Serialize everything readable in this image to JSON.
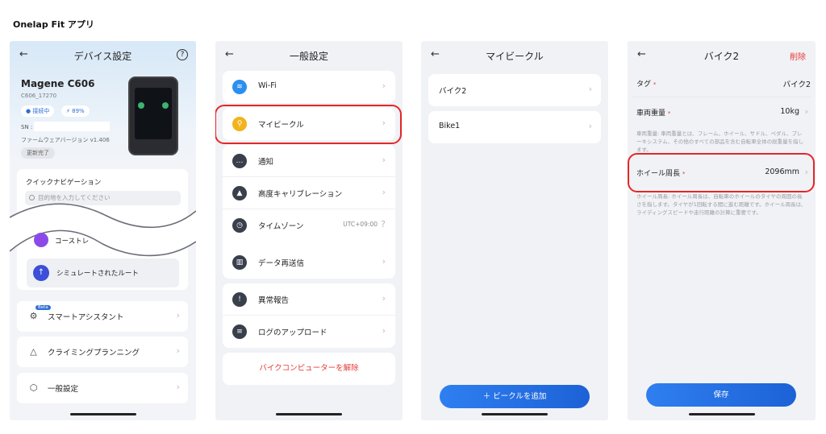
{
  "page": {
    "title": "Onelap Fit アプリ"
  },
  "colors": {
    "accent": "#2b6fd6",
    "danger": "#e53935",
    "highlight": "#e32727",
    "vehicle_icon": "#f2b31b"
  },
  "screen1": {
    "back_icon": "back-arrow-icon",
    "title": "デバイス設定",
    "help": "?",
    "device_name": "Magene C606",
    "device_id": "C606_17270",
    "connected": "● 接続中",
    "battery": "⚡ 89%",
    "sn_label": "SN :",
    "firmware": "ファームウェアバージョン  v1.406",
    "update_done": "更新完了",
    "quick_nav_title": "クイックナビゲーション",
    "search_placeholder": "目的地を入力してください",
    "course_training": "コーストレ",
    "simulated_route": "シミュレートされたルート",
    "beta": "Beta",
    "smart_assistant": "スマートアシスタント",
    "climbing_planning": "クライミングプランニング",
    "general_settings": "一般設定"
  },
  "screen2": {
    "title": "一般設定",
    "items": [
      {
        "label": "Wi-Fi",
        "icon": "wifi-icon",
        "value": ""
      },
      {
        "label": "マイビークル",
        "icon": "bike-icon",
        "value": ""
      },
      {
        "label": "通知",
        "icon": "chat-icon",
        "value": ""
      },
      {
        "label": "高度キャリブレーション",
        "icon": "mountain-icon",
        "value": ""
      },
      {
        "label": "タイムゾーン",
        "icon": "clock-icon",
        "value": "UTC+09:00"
      },
      {
        "label": "データ再送信",
        "icon": "chart-icon",
        "value": ""
      },
      {
        "label": "異常報告",
        "icon": "alert-icon",
        "value": ""
      },
      {
        "label": "ログのアップロード",
        "icon": "document-icon",
        "value": ""
      }
    ],
    "unpair": "バイクコンピューターを解除"
  },
  "screen3": {
    "title": "マイビークル",
    "vehicles": [
      {
        "label": "バイク2"
      },
      {
        "label": "Bike1"
      }
    ],
    "add_button": "＋ ビークルを追加"
  },
  "screen4": {
    "title": "バイク2",
    "delete": "削除",
    "tag_label": "タグ",
    "tag_value": "バイク2",
    "weight_label": "車両重量",
    "weight_value": "10kg",
    "weight_note": "車両重量: 車両重量とは、フレーム、ホイール、サドル、ペダル、ブレーキシステム、その他のすべての部品を含む自転車全体の総重量を指します。",
    "wheel_label": "ホイール周長",
    "wheel_value": "2096mm",
    "wheel_note": "ホイール周長: ホイール周長は、自転車のホイールのタイヤの周囲の長さを指します。タイヤが1回転する間に進む距離です。ホイール周長は、ライディングスピードや走行距離の計算に重要です。",
    "required_mark": "*",
    "save_button": "保存"
  }
}
